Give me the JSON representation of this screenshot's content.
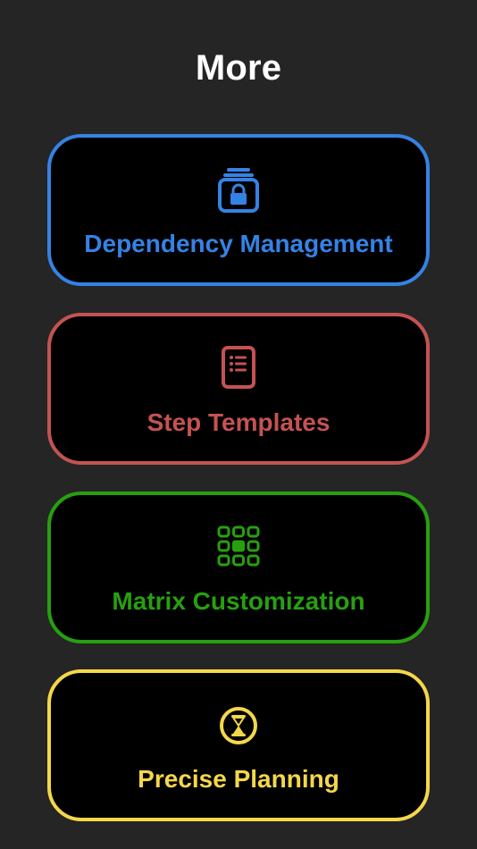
{
  "page": {
    "title": "More"
  },
  "items": [
    {
      "label": "Dependency Management",
      "icon": "locked-stack-icon",
      "color": "#3582e4"
    },
    {
      "label": "Step Templates",
      "icon": "list-document-icon",
      "color": "#c55252"
    },
    {
      "label": "Matrix Customization",
      "icon": "grid-icon",
      "color": "#27a00f"
    },
    {
      "label": "Precise Planning",
      "icon": "hourglass-icon",
      "color": "#f4d74a"
    }
  ],
  "colors": {
    "background": "#252525",
    "card_background": "#000000",
    "title": "#ffffff"
  }
}
